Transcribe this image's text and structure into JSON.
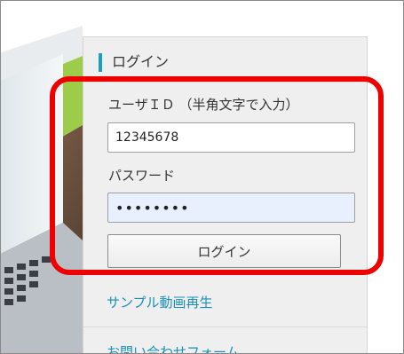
{
  "login_panel": {
    "title": "ログイン",
    "accent_color": "#1a9fbf",
    "userid_label": "ユーザＩＤ （半角文字で入力）",
    "userid_value": "12345678",
    "password_label": "パスワード",
    "password_value": "••••••••",
    "login_button_label": "ログイン"
  },
  "links": {
    "sample_video": "サンプル動画再生",
    "contact_form": "お問い合わせフォーム"
  },
  "highlight_color": "#ee0000"
}
